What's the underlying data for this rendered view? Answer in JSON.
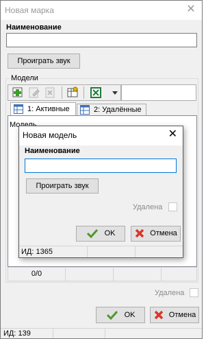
{
  "outer": {
    "title": "Новая марка",
    "name_label": "Наименование",
    "name_value": "",
    "play_sound_label": "Проиграть звук",
    "models_group_label": "Модели",
    "tabs": [
      {
        "label": "1: Активные"
      },
      {
        "label": "2: Удалённые"
      }
    ],
    "grid_column_header": "Модель",
    "grid_status_count": "0/0",
    "deleted_label": "Удалена",
    "ok_label": "OK",
    "cancel_label": "Отмена",
    "id_label": "ИД: 139"
  },
  "dialog": {
    "title": "Новая модель",
    "name_label": "Наименование",
    "name_value": "",
    "play_sound_label": "Проиграть звук",
    "deleted_label": "Удалена",
    "ok_label": "OK",
    "cancel_label": "Отмена",
    "id_label": "ИД: 1365"
  },
  "icons": {
    "close": "close-icon",
    "add": "add-green-icon",
    "edit": "edit-icon",
    "delete": "delete-icon",
    "table_settings": "table-settings-icon",
    "excel": "excel-export-icon",
    "dropdown": "chevron-down-icon",
    "ok": "checkmark-green-icon",
    "cancel": "x-red-icon",
    "tab": "table-grid-icon"
  },
  "colors": {
    "ok_check": "#4a9a2a",
    "cancel_x": "#d9362b",
    "focus_border": "#0078d7"
  }
}
